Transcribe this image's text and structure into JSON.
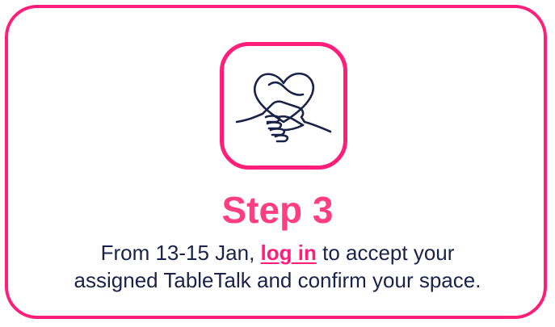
{
  "card": {
    "accent_color": "#ff1f7a",
    "text_color": "#1b2249",
    "icon": "handshake-heart-icon",
    "title": "Step 3",
    "description": {
      "before_link": "From 13-15 Jan, ",
      "link_text": "log in",
      "after_link_line1": " to accept your",
      "line2": "assigned TableTalk and confirm your space."
    }
  }
}
